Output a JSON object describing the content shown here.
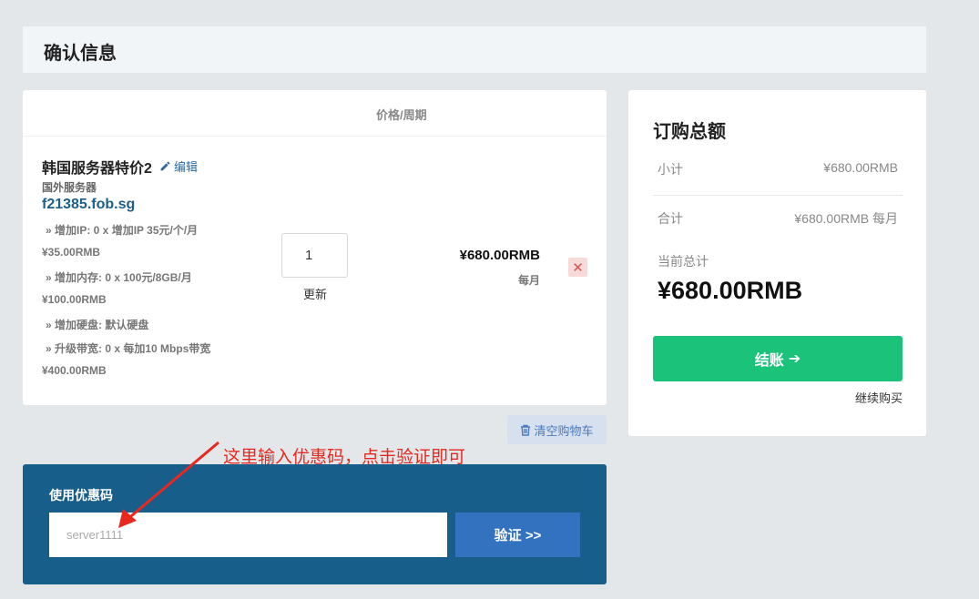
{
  "header": {
    "title": "确认信息"
  },
  "cart": {
    "column_header": "价格/周期",
    "item": {
      "name": "韩国服务器特价2",
      "edit_label": "编辑",
      "group": "国外服务器",
      "domain": "f21385.fob.sg",
      "options": [
        {
          "label": "» 增加IP: 0 x 增加IP 35元/个/月"
        },
        {
          "price": "¥35.00RMB"
        },
        {
          "label": "» 增加内存: 0 x 100元/8GB/月"
        },
        {
          "price": "¥100.00RMB"
        },
        {
          "label": "» 增加硬盘: 默认硬盘"
        },
        {
          "label": "» 升级带宽: 0 x 每加10 Mbps带宽"
        },
        {
          "price": "¥400.00RMB"
        }
      ],
      "quantity": "1",
      "update_label": "更新",
      "price": "¥680.00RMB",
      "cycle": "每月",
      "remove_icon": "close-icon"
    },
    "clear_label": "清空购物车"
  },
  "annotation": {
    "text": "这里输入优惠码，点击验证即可",
    "color": "#e8281e"
  },
  "promo": {
    "title": "使用优惠码",
    "input_value": "",
    "placeholder": "server1111",
    "verify_label": "验证 >>"
  },
  "summary": {
    "title": "订购总额",
    "subtotal_label": "小计",
    "subtotal_value": "¥680.00RMB",
    "total_label": "合计",
    "total_value": "¥680.00RMB 每月",
    "current_total_label": "当前总计",
    "current_total_value": "¥680.00RMB",
    "checkout_label": "结账",
    "continue_label": "继续购买"
  },
  "colors": {
    "checkout": "#1bc279",
    "promo_bg": "#175e8a",
    "verify_btn": "#3372be",
    "link": "#2c6aa0"
  }
}
